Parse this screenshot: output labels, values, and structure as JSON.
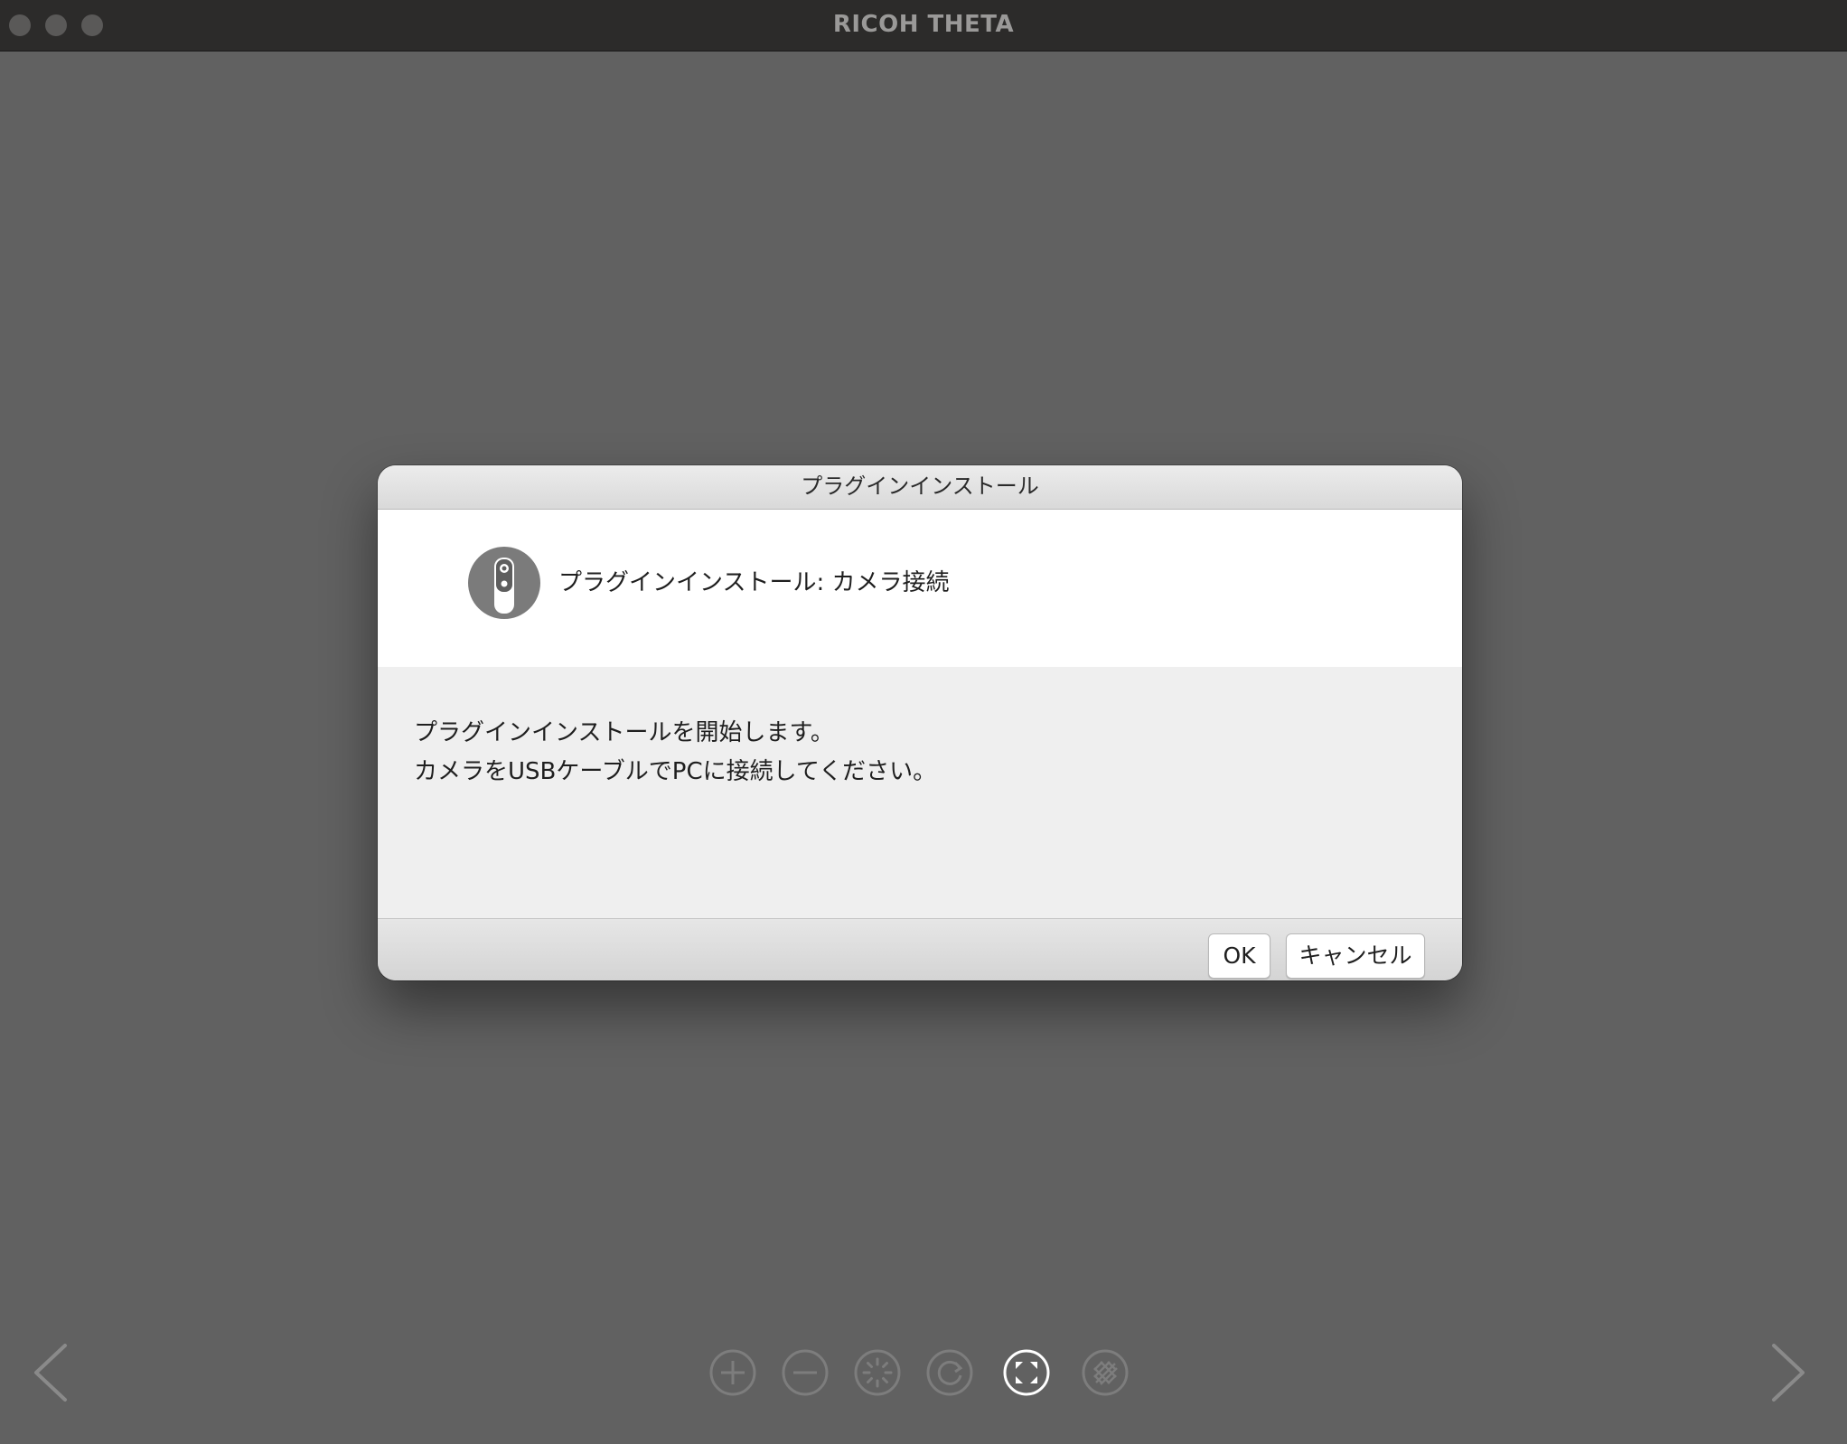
{
  "window": {
    "title": "RICOH THETA"
  },
  "dialog": {
    "title": "プラグインインストール",
    "header_text": "プラグインインストール: カメラ接続",
    "header_icon": "theta-camera-icon",
    "message_line1": "プラグインインストールを開始します。",
    "message_line2": "カメラをUSBケーブルでPCに接続してください。",
    "ok_label": "OK",
    "cancel_label": "キャンセル"
  },
  "toolbar": {
    "tools": [
      {
        "name": "zoom-in-icon",
        "active": false
      },
      {
        "name": "zoom-out-icon",
        "active": false
      },
      {
        "name": "brightness-icon",
        "active": false
      },
      {
        "name": "rotate-icon",
        "active": false
      },
      {
        "name": "fit-screen-icon",
        "active": true
      },
      {
        "name": "pattern-icon",
        "active": false
      }
    ]
  },
  "colors": {
    "background": "#616161",
    "titlebar": "#2c2b2a",
    "dialog_body": "#efefef",
    "icon_inactive": "#7d7d7d",
    "icon_active": "#ffffff"
  }
}
